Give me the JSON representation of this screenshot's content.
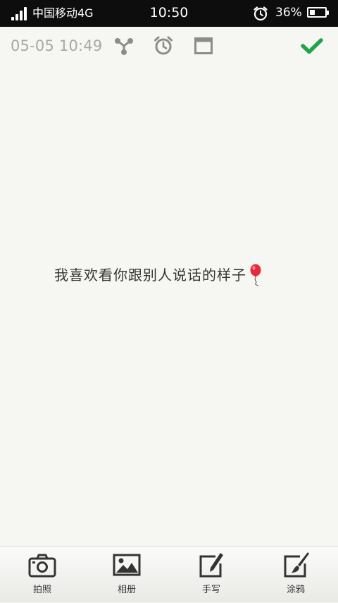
{
  "status_bar": {
    "carrier": "中国移动4G",
    "time": "10:50",
    "battery_percent": "36%",
    "battery_level": 0.36,
    "icons": [
      "signal-icon",
      "alarm-icon",
      "battery-icon"
    ]
  },
  "toolbar": {
    "date": "05-05 10:49",
    "icons": [
      "share-icon",
      "alarm-clock-icon",
      "window-icon",
      "checkmark-icon"
    ]
  },
  "note": {
    "text": "我喜欢看你跟别人说话的样子",
    "emoji_icon": "balloon-icon"
  },
  "bottom_bar": {
    "items": [
      {
        "label": "拍照",
        "icon": "camera-icon"
      },
      {
        "label": "相册",
        "icon": "picture-icon"
      },
      {
        "label": "手写",
        "icon": "handwrite-icon"
      },
      {
        "label": "涂鸦",
        "icon": "brush-icon"
      }
    ]
  },
  "colors": {
    "background": "#f6f6f2",
    "status_bar": "#0d0d0d",
    "date_text": "#a8a8a8",
    "toolbar_icon": "#8c8c8c",
    "confirm_green": "#1fa44b",
    "note_text": "#333333",
    "balloon_red": "#e8293b"
  }
}
